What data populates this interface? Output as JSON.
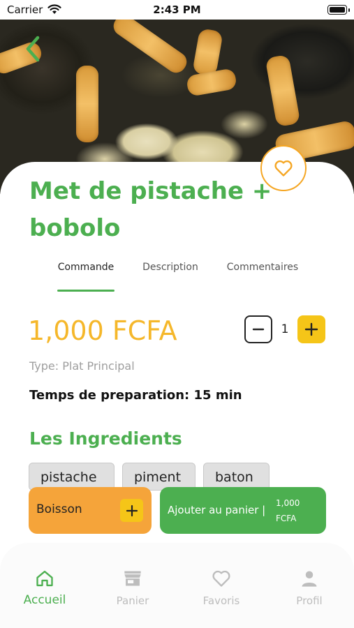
{
  "status_bar": {
    "carrier": "Carrier",
    "time": "2:43 PM"
  },
  "product": {
    "title": "Met de pistache + bobolo",
    "price": "1,000 FCFA",
    "type": "Type: Plat Principal",
    "prep_time": "Temps de preparation: 15 min"
  },
  "tabs": [
    {
      "label": "Commande",
      "active": true
    },
    {
      "label": "Description",
      "active": false
    },
    {
      "label": "Commentaires",
      "active": false
    }
  ],
  "quantity": {
    "value": "1"
  },
  "ingredients": {
    "title": "Les Ingredients",
    "items": [
      "pistache",
      "piment",
      "baton"
    ]
  },
  "actions": {
    "boisson_label": "Boisson",
    "add_to_cart_label": "Ajouter au panier |",
    "add_to_cart_price": "1,000 FCFA"
  },
  "nav": [
    {
      "label": "Accueil",
      "icon": "home-icon",
      "active": true
    },
    {
      "label": "Panier",
      "icon": "store-icon",
      "active": false
    },
    {
      "label": "Favoris",
      "icon": "heart-icon",
      "active": false
    },
    {
      "label": "Profil",
      "icon": "person-icon",
      "active": false
    }
  ],
  "colors": {
    "primary_green": "#4caf50",
    "accent_yellow": "#f5c518",
    "price_yellow": "#f5b72a",
    "orange": "#f5a43a",
    "inactive_gray": "#bdbdbd"
  }
}
